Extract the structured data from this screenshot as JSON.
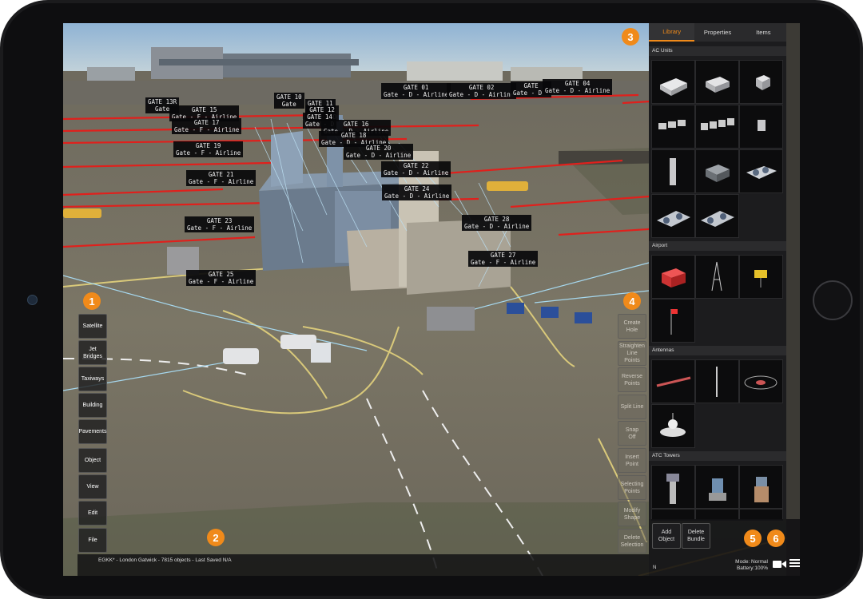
{
  "left_toolbar": {
    "badge": "1",
    "buttons": [
      "Satellite",
      "Jet\nBridges",
      "Taxiways",
      "Building",
      "Pavements",
      "Object",
      "View",
      "Edit",
      "File"
    ]
  },
  "status_bar": {
    "badge": "2",
    "text": "EGKK* - London Gatwick - 7815 objects - Last Saved N/A"
  },
  "library_panel": {
    "badge": "3",
    "tabs": [
      "Library",
      "Properties",
      "Items"
    ],
    "active_tab": "Library",
    "sections": [
      {
        "title": "AC Units",
        "item_count": 11
      },
      {
        "title": "Airport",
        "item_count": 4
      },
      {
        "title": "Antennas",
        "item_count": 4
      },
      {
        "title": "ATC Towers",
        "item_count": 6
      }
    ]
  },
  "right_toolbar": {
    "badge": "4",
    "buttons": [
      "Create\nHole",
      "Straighten\nLine Points",
      "Reverse\nPoints",
      "Split Line",
      "Snap\nOff",
      "Insert\nPoint",
      "Selecting\nPoints",
      "Modify\nShape",
      "Delete\nSelection"
    ]
  },
  "bottom_panel": {
    "add_object": "Add\nObject",
    "delete_bundle": "Delete\nBundle",
    "mode": "Mode: Normal",
    "battery": "Battery:100%",
    "camera_badge": "5",
    "menu_badge": "6",
    "compass": "N"
  },
  "gates": [
    {
      "name": "GATE 01",
      "sub": "Gate - D - Airline"
    },
    {
      "name": "GATE 02",
      "sub": "Gate - D - Airline"
    },
    {
      "name": "GATE",
      "sub": "Gate - D -"
    },
    {
      "name": "GATE 04",
      "sub": "Gate - D - Airline"
    },
    {
      "name": "GATE 10",
      "sub": "Gate"
    },
    {
      "name": "GATE 13R",
      "sub": "Gate"
    },
    {
      "name": "GATE 11",
      "sub": "Gate -"
    },
    {
      "name": "GATE 15",
      "sub": "Gate - F - Airline"
    },
    {
      "name": "GATE 12",
      "sub": "Gate - D"
    },
    {
      "name": "GATE 14",
      "sub": "Gate - D"
    },
    {
      "name": "GATE 17",
      "sub": "Gate - F - Airline"
    },
    {
      "name": "GATE 16",
      "sub": "Gate - D - Airline"
    },
    {
      "name": "GATE 18",
      "sub": "Gate - D - Airline"
    },
    {
      "name": "GATE 19",
      "sub": "Gate - F - Airline"
    },
    {
      "name": "GATE 20",
      "sub": "Gate - D - Airline"
    },
    {
      "name": "GATE 22",
      "sub": "Gate - D - Airline"
    },
    {
      "name": "GATE 21",
      "sub": "Gate - F - Airline"
    },
    {
      "name": "GATE 24",
      "sub": "Gate - D - Airline"
    },
    {
      "name": "GATE 23",
      "sub": "Gate - F - Airline"
    },
    {
      "name": "GATE 28",
      "sub": "Gate - D - Airline"
    },
    {
      "name": "GATE 27",
      "sub": "Gate - F - Airline"
    },
    {
      "name": "GATE 25",
      "sub": "Gate - F - Airline"
    }
  ],
  "colors": {
    "accent": "#f08a1a",
    "panel_bg": "#1c1c1e",
    "gate_line": "#e0201c",
    "sky": "#9cbcd4",
    "tarmac": "#7a7565"
  }
}
